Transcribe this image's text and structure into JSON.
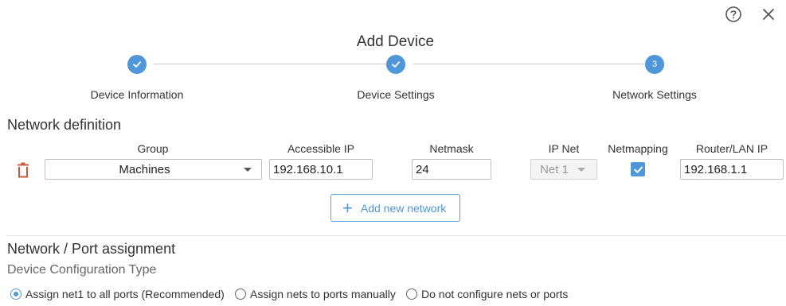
{
  "dialog": {
    "title": "Add Device",
    "help_icon": "help-circle-icon",
    "close_icon": "close-icon"
  },
  "stepper": {
    "steps": [
      {
        "label": "Device Information",
        "state": "complete",
        "icon": "check-icon"
      },
      {
        "label": "Device Settings",
        "state": "complete",
        "icon": "check-icon"
      },
      {
        "label": "Network Settings",
        "state": "active",
        "number": "3"
      }
    ],
    "accent_color": "#4f97d8"
  },
  "network_definition": {
    "title": "Network definition",
    "columns": {
      "group": "Group",
      "accessible_ip": "Accessible IP",
      "netmask": "Netmask",
      "ip_net": "IP Net",
      "netmapping": "Netmapping",
      "router_lan_ip": "Router/LAN IP"
    },
    "rows": [
      {
        "delete_icon": "trash-icon",
        "group": "Machines",
        "accessible_ip": "192.168.10.1",
        "netmask": "24",
        "ip_net": "Net 1",
        "netmapping": true,
        "router_lan_ip": "192.168.1.1"
      }
    ],
    "add_button": "Add new network",
    "delete_color": "#c85a3c"
  },
  "port_assignment": {
    "title": "Network / Port assignment",
    "subtitle": "Device Configuration Type",
    "options": [
      {
        "label": "Assign net1 to all ports (Recommended)",
        "selected": true
      },
      {
        "label": "Assign nets to ports manually",
        "selected": false
      },
      {
        "label": "Do not configure nets or ports",
        "selected": false
      }
    ]
  }
}
